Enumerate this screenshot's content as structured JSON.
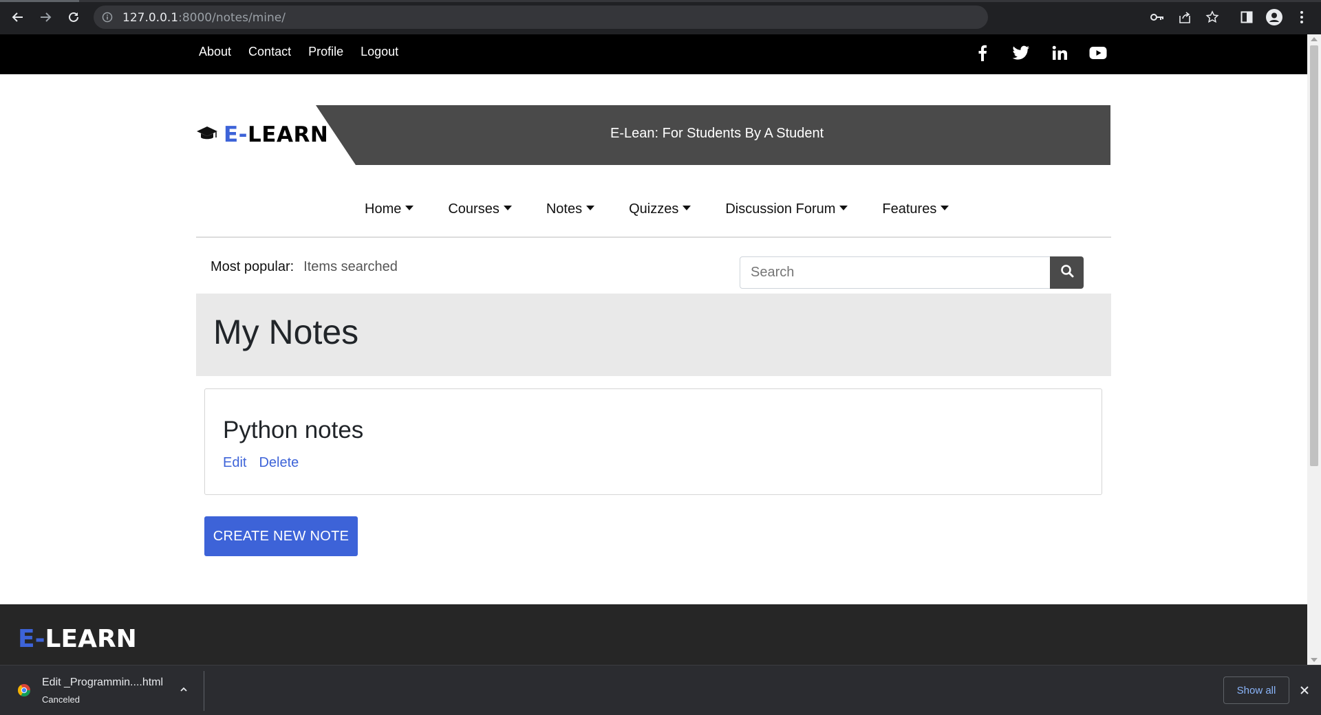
{
  "browser": {
    "url_host": "127.0.0.1",
    "url_path": ":8000/notes/mine/"
  },
  "topbar": {
    "links": [
      "About",
      "Contact",
      "Profile",
      "Logout"
    ],
    "social_icons": [
      "facebook-icon",
      "twitter-icon",
      "linkedin-icon",
      "youtube-icon"
    ]
  },
  "header": {
    "logo_prefix": "E-",
    "logo_text": "LEARN",
    "tagline": "E-Lean: For Students By A Student"
  },
  "nav": {
    "items": [
      "Home",
      "Courses",
      "Notes",
      "Quizzes",
      "Discussion Forum",
      "Features"
    ]
  },
  "popular": {
    "label": "Most popular:",
    "items": "Items searched"
  },
  "search": {
    "placeholder": "Search"
  },
  "page": {
    "title": "My Notes"
  },
  "notes": [
    {
      "title": "Python notes",
      "edit_label": "Edit",
      "delete_label": "Delete"
    }
  ],
  "create_button": "CREATE NEW NOTE",
  "footer": {
    "logo_prefix": "E-",
    "logo_text": "LEARN"
  },
  "download": {
    "filename": "Edit _Programmin....html",
    "status": "Canceled",
    "show_all": "Show all"
  },
  "colors": {
    "accent": "#3d63d8",
    "topbar": "#000000",
    "banner": "#4a4a4a",
    "footer": "#262626"
  }
}
